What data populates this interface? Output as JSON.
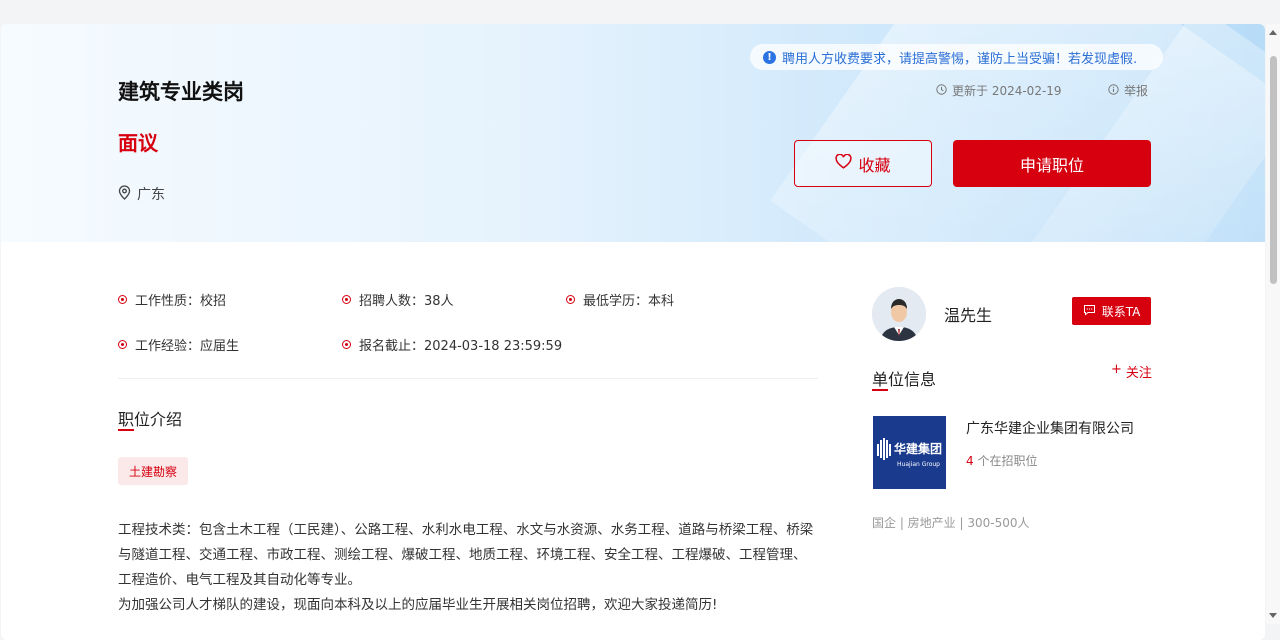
{
  "job": {
    "title": "建筑专业类岗",
    "salary": "面议",
    "location": "广东"
  },
  "notice": {
    "text": "聘用人方收费要求，请提高警惕，谨防上当受骗！若发现虚假.",
    "icon": "info-icon"
  },
  "meta": {
    "updated": "更新于 2024-02-19",
    "report": "举报"
  },
  "actions": {
    "favorite": "收藏",
    "apply": "申请职位"
  },
  "attributes": [
    {
      "label": "工作性质：",
      "value": "校招"
    },
    {
      "label": "招聘人数：",
      "value": "38人"
    },
    {
      "label": "最低学历：",
      "value": "本科"
    },
    {
      "label": "工作经验：",
      "value": "应届生"
    },
    {
      "label": "报名截止：",
      "value": "2024-03-18 23:59:59"
    }
  ],
  "intro": {
    "title": "职位介绍",
    "tag": "土建勘察",
    "line1": "工程技术类：包含土木工程（工民建）、公路工程、水利水电工程、水文与水资源、水务工程、道路与桥梁工程、桥梁与隧道工程、交通工程、市政工程、测绘工程、爆破工程、地质工程、环境工程、安全工程、工程爆破、工程管理、工程造价、电气工程及其自动化等专业。",
    "line2": "为加强公司人才梯队的建设，现面向本科及以上的应届毕业生开展相关岗位招聘，欢迎大家投递简历!"
  },
  "recruiter": {
    "name": "温先生",
    "contact": "联系TA"
  },
  "company": {
    "section_title": "单位信息",
    "follow": "关注",
    "logo_text": "华建集团",
    "logo_sub": "Huajian Group",
    "name": "广东华建企业集团有限公司",
    "openings_count": "4",
    "openings_label": "个在招职位",
    "meta": "国企 | 房地产业 | 300-500人"
  },
  "colors": {
    "accent": "#d6000f",
    "notice": "#2b6fd6",
    "logo_bg": "#1a3b8d"
  }
}
